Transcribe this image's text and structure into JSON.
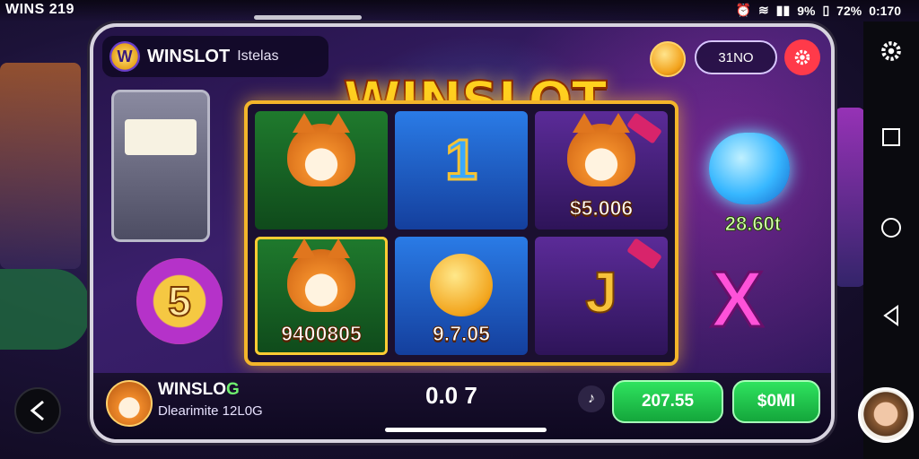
{
  "status_bar": {
    "carrier": "WINS 219",
    "battery_text": "9%",
    "signal_text": "72%",
    "time": "0:170"
  },
  "app": {
    "name": "WINSLOT",
    "sub": "Istelas",
    "coin_balance": "31NO",
    "title": "WINSLOT"
  },
  "grid": {
    "cells": [
      {
        "value": ""
      },
      {
        "value": ""
      },
      {
        "value": "$5.006"
      },
      {
        "value": "9400805"
      },
      {
        "value": "9.7.05"
      },
      {
        "value": ""
      }
    ],
    "symbols": {
      "reel2": "1",
      "reel6": "J"
    }
  },
  "side": {
    "left_coin": "5",
    "right_value": "28.60t"
  },
  "player": {
    "name": "WINSLO",
    "name_suffix": "G",
    "sub": "Dlearimite 12L0G"
  },
  "bet": {
    "value": "0.0 7"
  },
  "buttons": {
    "spin_amount": "207.55",
    "cash_label": "$0MI"
  },
  "colors": {
    "accent": "#ffd21f",
    "green": "#1fcf4a",
    "danger": "#ff3a4a"
  }
}
